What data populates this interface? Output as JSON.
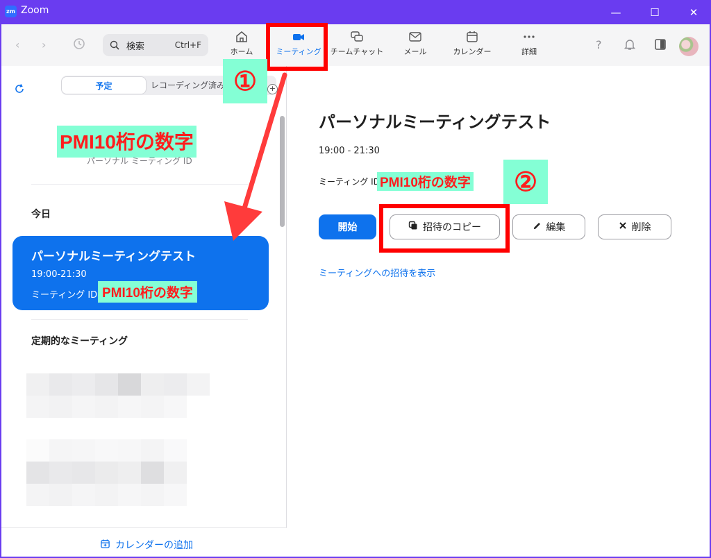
{
  "window": {
    "title": "Zoom",
    "logo_text": "zm",
    "controls": {
      "minimize": "—",
      "maximize": "☐",
      "close": "✕"
    }
  },
  "toolbar": {
    "search": {
      "label": "検索",
      "shortcut": "Ctrl+F"
    },
    "tabs": [
      {
        "label": "ホーム",
        "icon": "home-icon"
      },
      {
        "label": "ミーティング",
        "icon": "video-camera-icon",
        "active": true
      },
      {
        "label": "チームチャット",
        "icon": "chat-icon"
      },
      {
        "label": "メール",
        "icon": "mail-icon"
      },
      {
        "label": "カレンダー",
        "icon": "calendar-icon"
      },
      {
        "label": "詳細",
        "icon": "more-dots-icon"
      }
    ],
    "help_glyph": "?"
  },
  "sidebar": {
    "segment": {
      "upcoming": "予定",
      "recorded": "レコーディング済み"
    },
    "pmi_number_highlight": "PMI10桁の数字",
    "pmi_label": "パーソナル ミーティング ID",
    "today_title": "今日",
    "card": {
      "title": "パーソナルミーティングテスト",
      "time": "19:00-21:30",
      "id_label": "ミーティング ID: 3",
      "pmi_highlight": "PMI10桁の数字"
    },
    "recurring_title": "定期的なミーティング",
    "add_calendar": "カレンダーの追加"
  },
  "detail": {
    "title": "パーソナルミーティングテスト",
    "time": "19:00 - 21:30",
    "id_label": "ミーティング ID:",
    "pmi_highlight": "PMI10桁の数字",
    "buttons": {
      "start": "開始",
      "copy_invite": "招待のコピー",
      "edit": "編集",
      "delete": "削除"
    },
    "show_invite": "ミーティングへの招待を表示"
  },
  "annotations": {
    "step1": "①",
    "step2": "②",
    "highlight_color": "#84ffd5",
    "box_color": "#ff0000"
  },
  "colors": {
    "titlebar": "#6a3cf0",
    "accent_blue": "#0e72ed"
  }
}
